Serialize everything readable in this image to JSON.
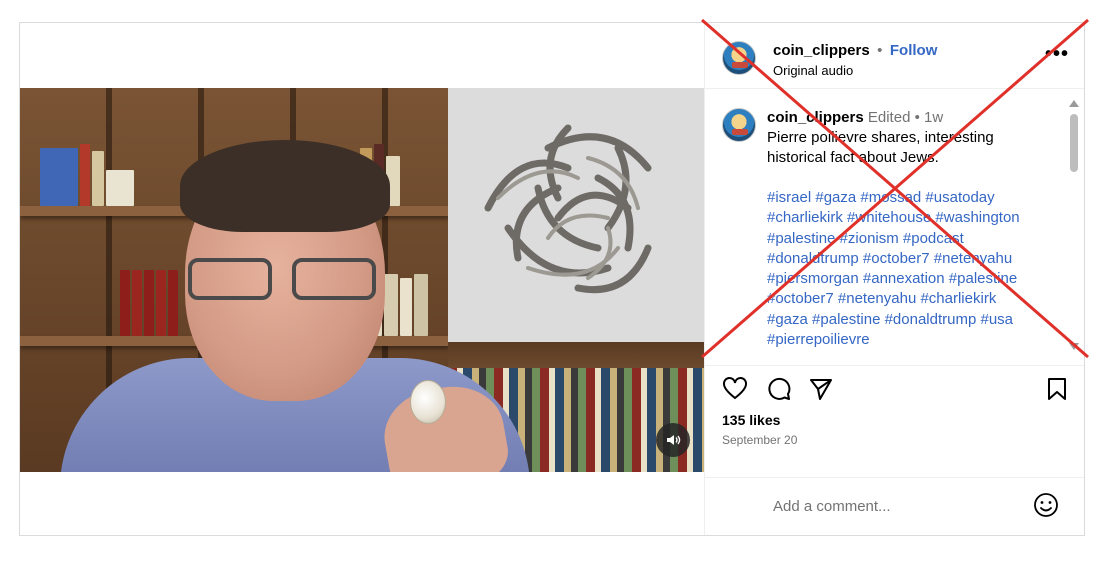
{
  "post": {
    "author": "coin_clippers",
    "separator": "•",
    "follow_label": "Follow",
    "audio_label": "Original audio",
    "more_label": "•••",
    "caption": {
      "author": "coin_clippers",
      "edited_label": "Edited •",
      "age": "1w",
      "text": "Pierre poilievre shares, interesting historical fact about Jews.",
      "hashtags": [
        "#israel #gaza #mossad #usatoday",
        "#charliekirk #whitehouse #washington",
        "#palestine #zionism #podcast",
        "#donaldtrump #october7 #netenyahu",
        "#piersmorgan #annexation #palestine",
        "#october7 #netenyahu #charliekirk",
        "#gaza #palestine #donaldtrump #usa",
        "#pierrepoilievre"
      ]
    },
    "likes": "135 likes",
    "date": "September 20",
    "comment_placeholder": "Add a comment..."
  },
  "icons": {
    "like": "heart-icon",
    "comment": "comment-icon",
    "share": "share-icon",
    "save": "bookmark-icon",
    "emoji": "emoji-icon",
    "mute": "speaker-icon"
  },
  "colors": {
    "link_blue": "#3567c4",
    "muted_text": "#737373",
    "border": "#dbdbdb",
    "overlay_x": "#e0302a"
  }
}
